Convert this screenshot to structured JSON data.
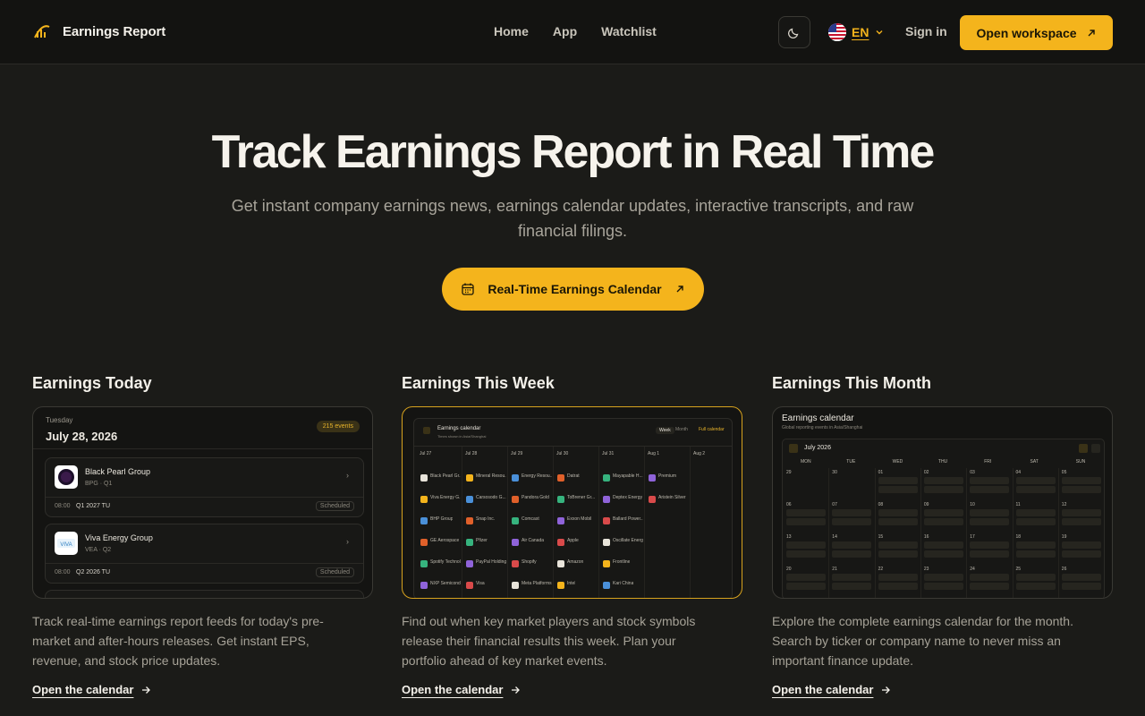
{
  "nav": {
    "brand": "Earnings Report",
    "links": [
      "Home",
      "App",
      "Watchlist"
    ],
    "lang": "EN",
    "signin": "Sign in",
    "open_workspace": "Open workspace"
  },
  "hero": {
    "title": "Track Earnings Report in Real Time",
    "subtitle": "Get instant company earnings news, earnings calendar updates, interactive transcripts, and raw financial filings.",
    "cta": "Real-Time Earnings Calendar"
  },
  "colors": {
    "accent": "#f4b41c",
    "background": "#1b1b18"
  },
  "sections": [
    {
      "title": "Earnings Today",
      "desc": "Track real-time earnings report feeds for today's pre-market and after-hours releases. Get instant EPS, revenue, and stock price updates.",
      "link": "Open the calendar"
    },
    {
      "title": "Earnings This Week",
      "desc": "Find out when key market players and stock symbols release their financial results this week. Plan your portfolio ahead of key market events.",
      "link": "Open the calendar"
    },
    {
      "title": "Earnings This Month",
      "desc": "Explore the complete earnings calendar for the month. Search by ticker or company name to never miss an important finance update.",
      "link": "Open the calendar"
    }
  ],
  "today_preview": {
    "day": "Tuesday",
    "date": "July 28, 2026",
    "badge": "215 events",
    "items": [
      {
        "name": "Black Pearl Group",
        "ticker": "BPG · Q1",
        "time": "08:00",
        "quarter": "Q1 2027 TU",
        "status": "Scheduled"
      },
      {
        "name": "Viva Energy Group",
        "ticker": "VEA · Q2",
        "time": "08:00",
        "quarter": "Q2 2026 TU",
        "status": "Scheduled"
      }
    ]
  },
  "week_preview": {
    "title": "Earnings calendar",
    "subtitle": "Times shown in Asia/Shanghai",
    "tabs": [
      "Week",
      "Month"
    ],
    "full": "Full calendar",
    "days": [
      "Jul 27",
      "Jul 28",
      "Jul 29",
      "Jul 30",
      "Jul 31",
      "Aug 1",
      "Aug 2"
    ],
    "companies": [
      [
        "Black Pearl Gr...",
        "Viva Energy G...",
        "BHP Group",
        "GE Aerospace",
        "Spotify Technology",
        "NXP Semiconductors"
      ],
      [
        "Mineral Resou...",
        "Carsosodo G...",
        "Snap Inc.",
        "Pfizer",
        "PayPal Holdings",
        "Visa"
      ],
      [
        "Energy Resou...",
        "Pandora Gold",
        "Comcast",
        "Air Canada",
        "Shopify",
        "Meta Platforms"
      ],
      [
        "Datrat",
        "ToBrener Gr...",
        "Exxon Mobil",
        "Apple",
        "Amazon",
        "Intel"
      ],
      [
        "Mayapable H...",
        "Deptex Energy",
        "Ballard Power...",
        "Oscillate Energy",
        "Frontline",
        "Kari China"
      ],
      [
        "Premium",
        "Aristein Silver"
      ]
    ]
  },
  "month_preview": {
    "title": "Earnings calendar",
    "subtitle": "Global reporting events in Asia/Shanghai",
    "month": "July 2026",
    "weekdays": [
      "MON",
      "TUE",
      "WED",
      "THU",
      "FRI",
      "SAT",
      "SUN"
    ]
  }
}
